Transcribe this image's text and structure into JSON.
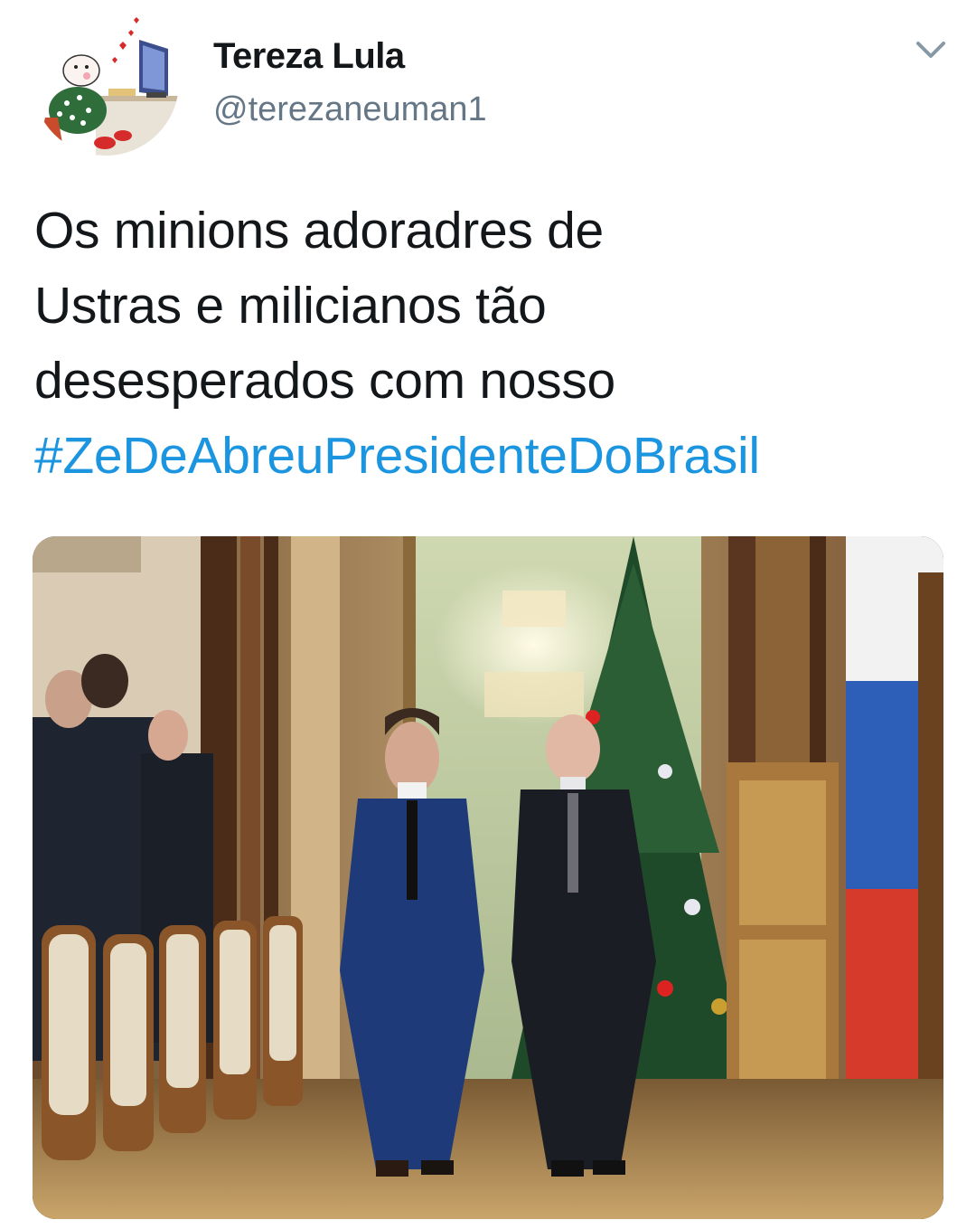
{
  "tweet": {
    "author": {
      "name": "Tereza Lula",
      "handle": "@terezaneuman1"
    },
    "text_lines": [
      "Os minions adoradres de",
      "Ustras e milicianos tão",
      "desesperados com nosso"
    ],
    "hashtag": "#ZeDeAbreuPresidenteDoBrasil"
  },
  "colors": {
    "text": "#14171a",
    "secondary": "#657786",
    "link": "#1b95e0",
    "chevron": "#8899a6"
  },
  "icons": {
    "menu": "chevron-down-icon"
  }
}
